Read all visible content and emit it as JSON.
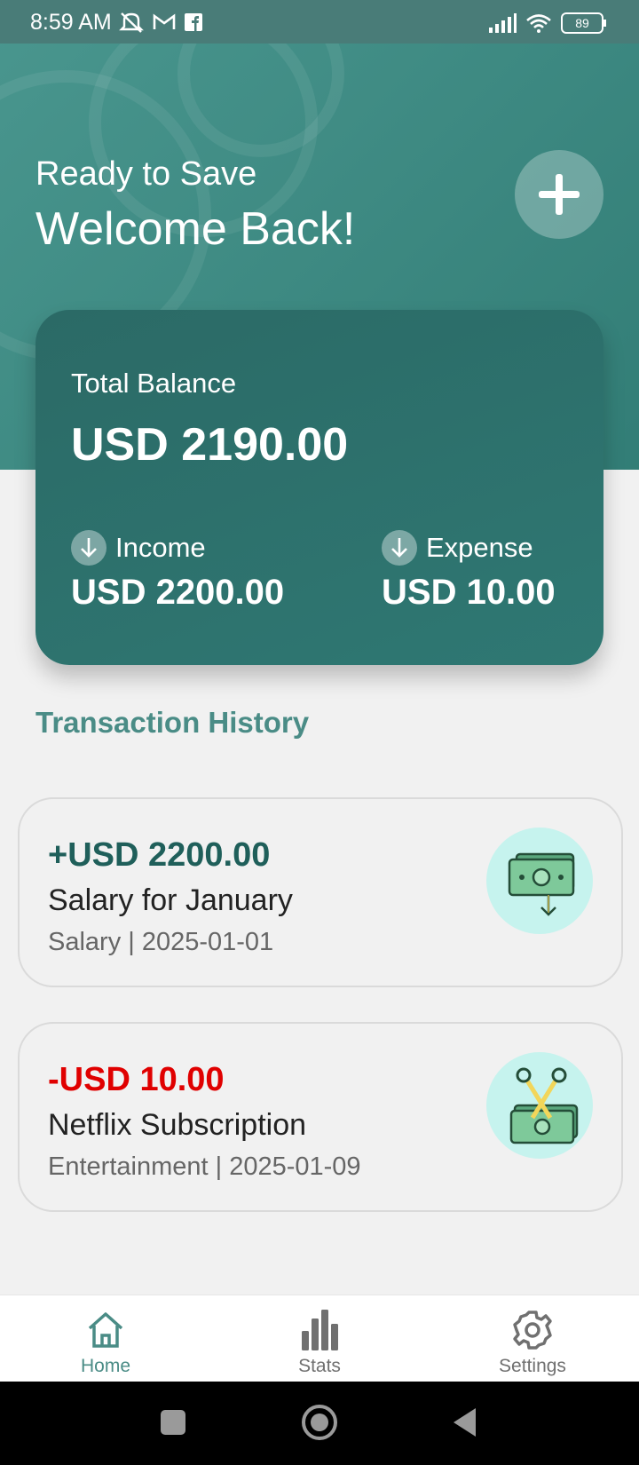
{
  "status_bar": {
    "time": "8:59 AM",
    "battery": "89",
    "icons": [
      "mute-icon",
      "gmail-icon",
      "facebook-icon",
      "signal-icon",
      "wifi-icon",
      "battery-icon"
    ]
  },
  "header": {
    "subtitle": "Ready to Save",
    "title": "Welcome Back!"
  },
  "balance": {
    "label": "Total Balance",
    "value": "USD 2190.00",
    "income_label": "Income",
    "income_value": "USD 2200.00",
    "expense_label": "Expense",
    "expense_value": "USD 10.00"
  },
  "transactions": {
    "title": "Transaction History",
    "items": [
      {
        "amount": "+USD 2200.00",
        "title": "Salary for January",
        "meta": "Salary | 2025-01-01",
        "color": "#1f5f5a",
        "icon": "salary-money-icon"
      },
      {
        "amount": "-USD 10.00",
        "title": "Netflix Subscription",
        "meta": "Entertainment | 2025-01-09",
        "color": "#e00000",
        "icon": "expense-scissors-money-icon"
      }
    ]
  },
  "nav": {
    "home": "Home",
    "stats": "Stats",
    "settings": "Settings",
    "active_color": "#4a8c86",
    "inactive_color": "#707070"
  },
  "colors": {
    "primary": "#2f7a73",
    "income": "#1f5f5a",
    "expense": "#e00000",
    "icon_bg": "#c6f3ee"
  }
}
